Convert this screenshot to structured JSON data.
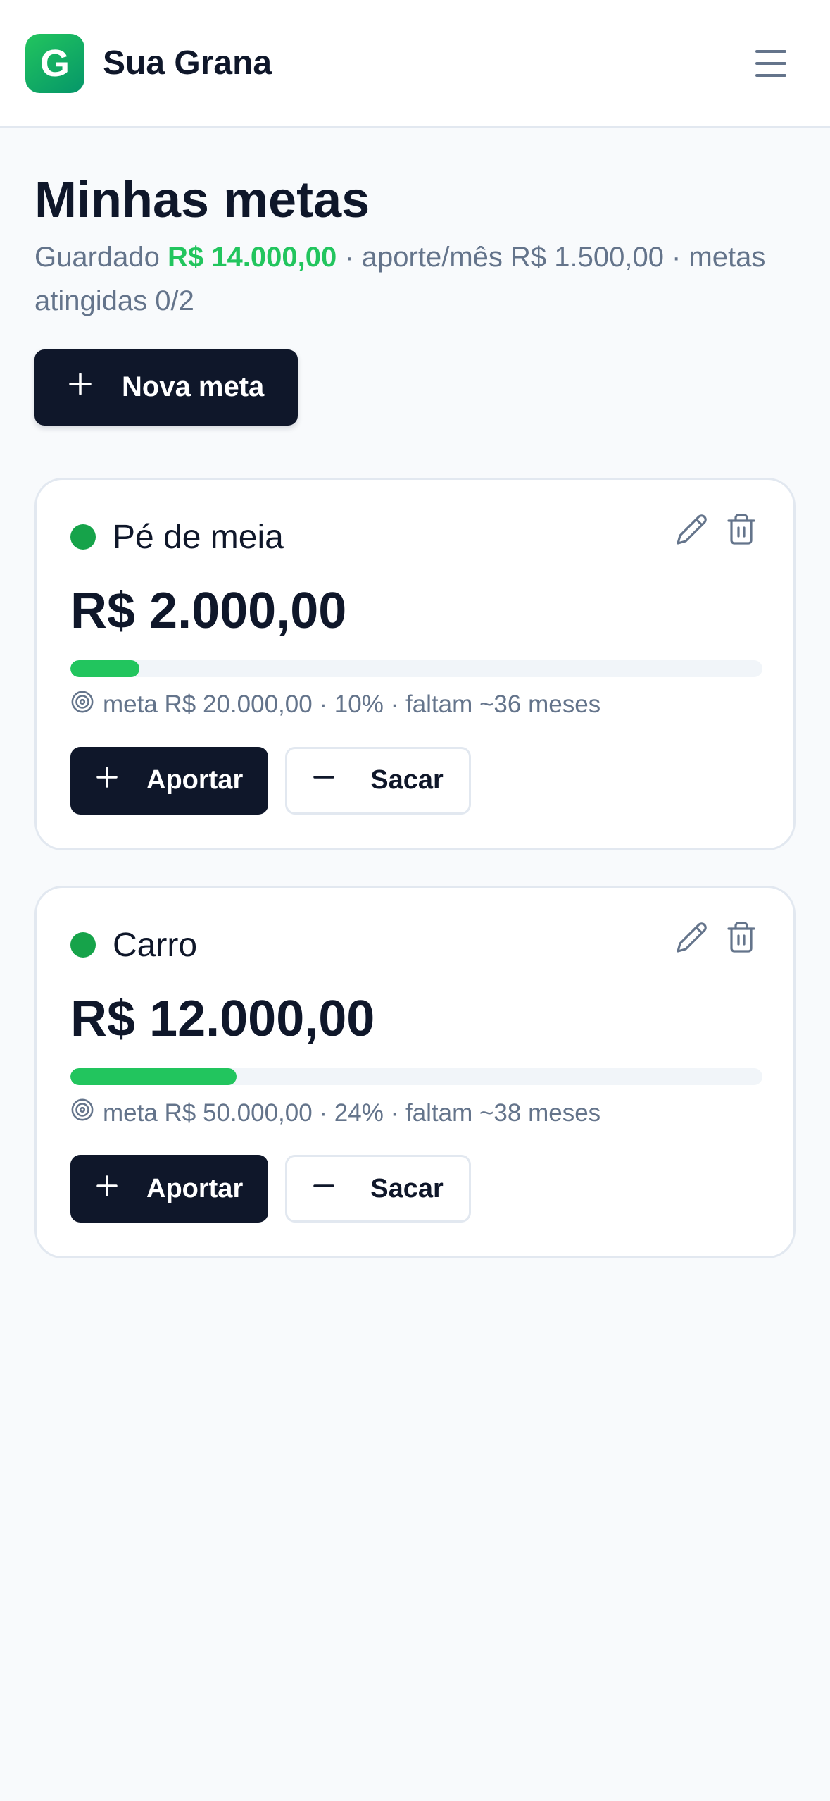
{
  "header": {
    "logo_letter": "G",
    "app_name": "Sua Grana",
    "menu_icon": "hamburger-menu-icon"
  },
  "page": {
    "title": "Minhas metas",
    "summary_prefix": "Guardado ",
    "saved_total": "R$ 14.000,00",
    "summary_suffix": " · aporte/mês R$ 1.500,00 · metas atingidas 0/2",
    "new_goal_label": "Nova meta"
  },
  "colors": {
    "accent_green": "#22c55e",
    "dark": "#0f172a",
    "muted": "#64748b",
    "dot_green": "#16a34a"
  },
  "goals": [
    {
      "name": "Pé de meia",
      "amount": "R$ 2.000,00",
      "progress": 0.1,
      "details": "meta R$ 20.000,00 · 10% · faltam ~36 meses",
      "contribute_label": "Aportar",
      "withdraw_label": "Sacar"
    },
    {
      "name": "Carro",
      "amount": "R$ 12.000,00",
      "progress": 0.24,
      "details": "meta R$ 50.000,00 · 24% · faltam ~38 meses",
      "contribute_label": "Aportar",
      "withdraw_label": "Sacar"
    }
  ]
}
